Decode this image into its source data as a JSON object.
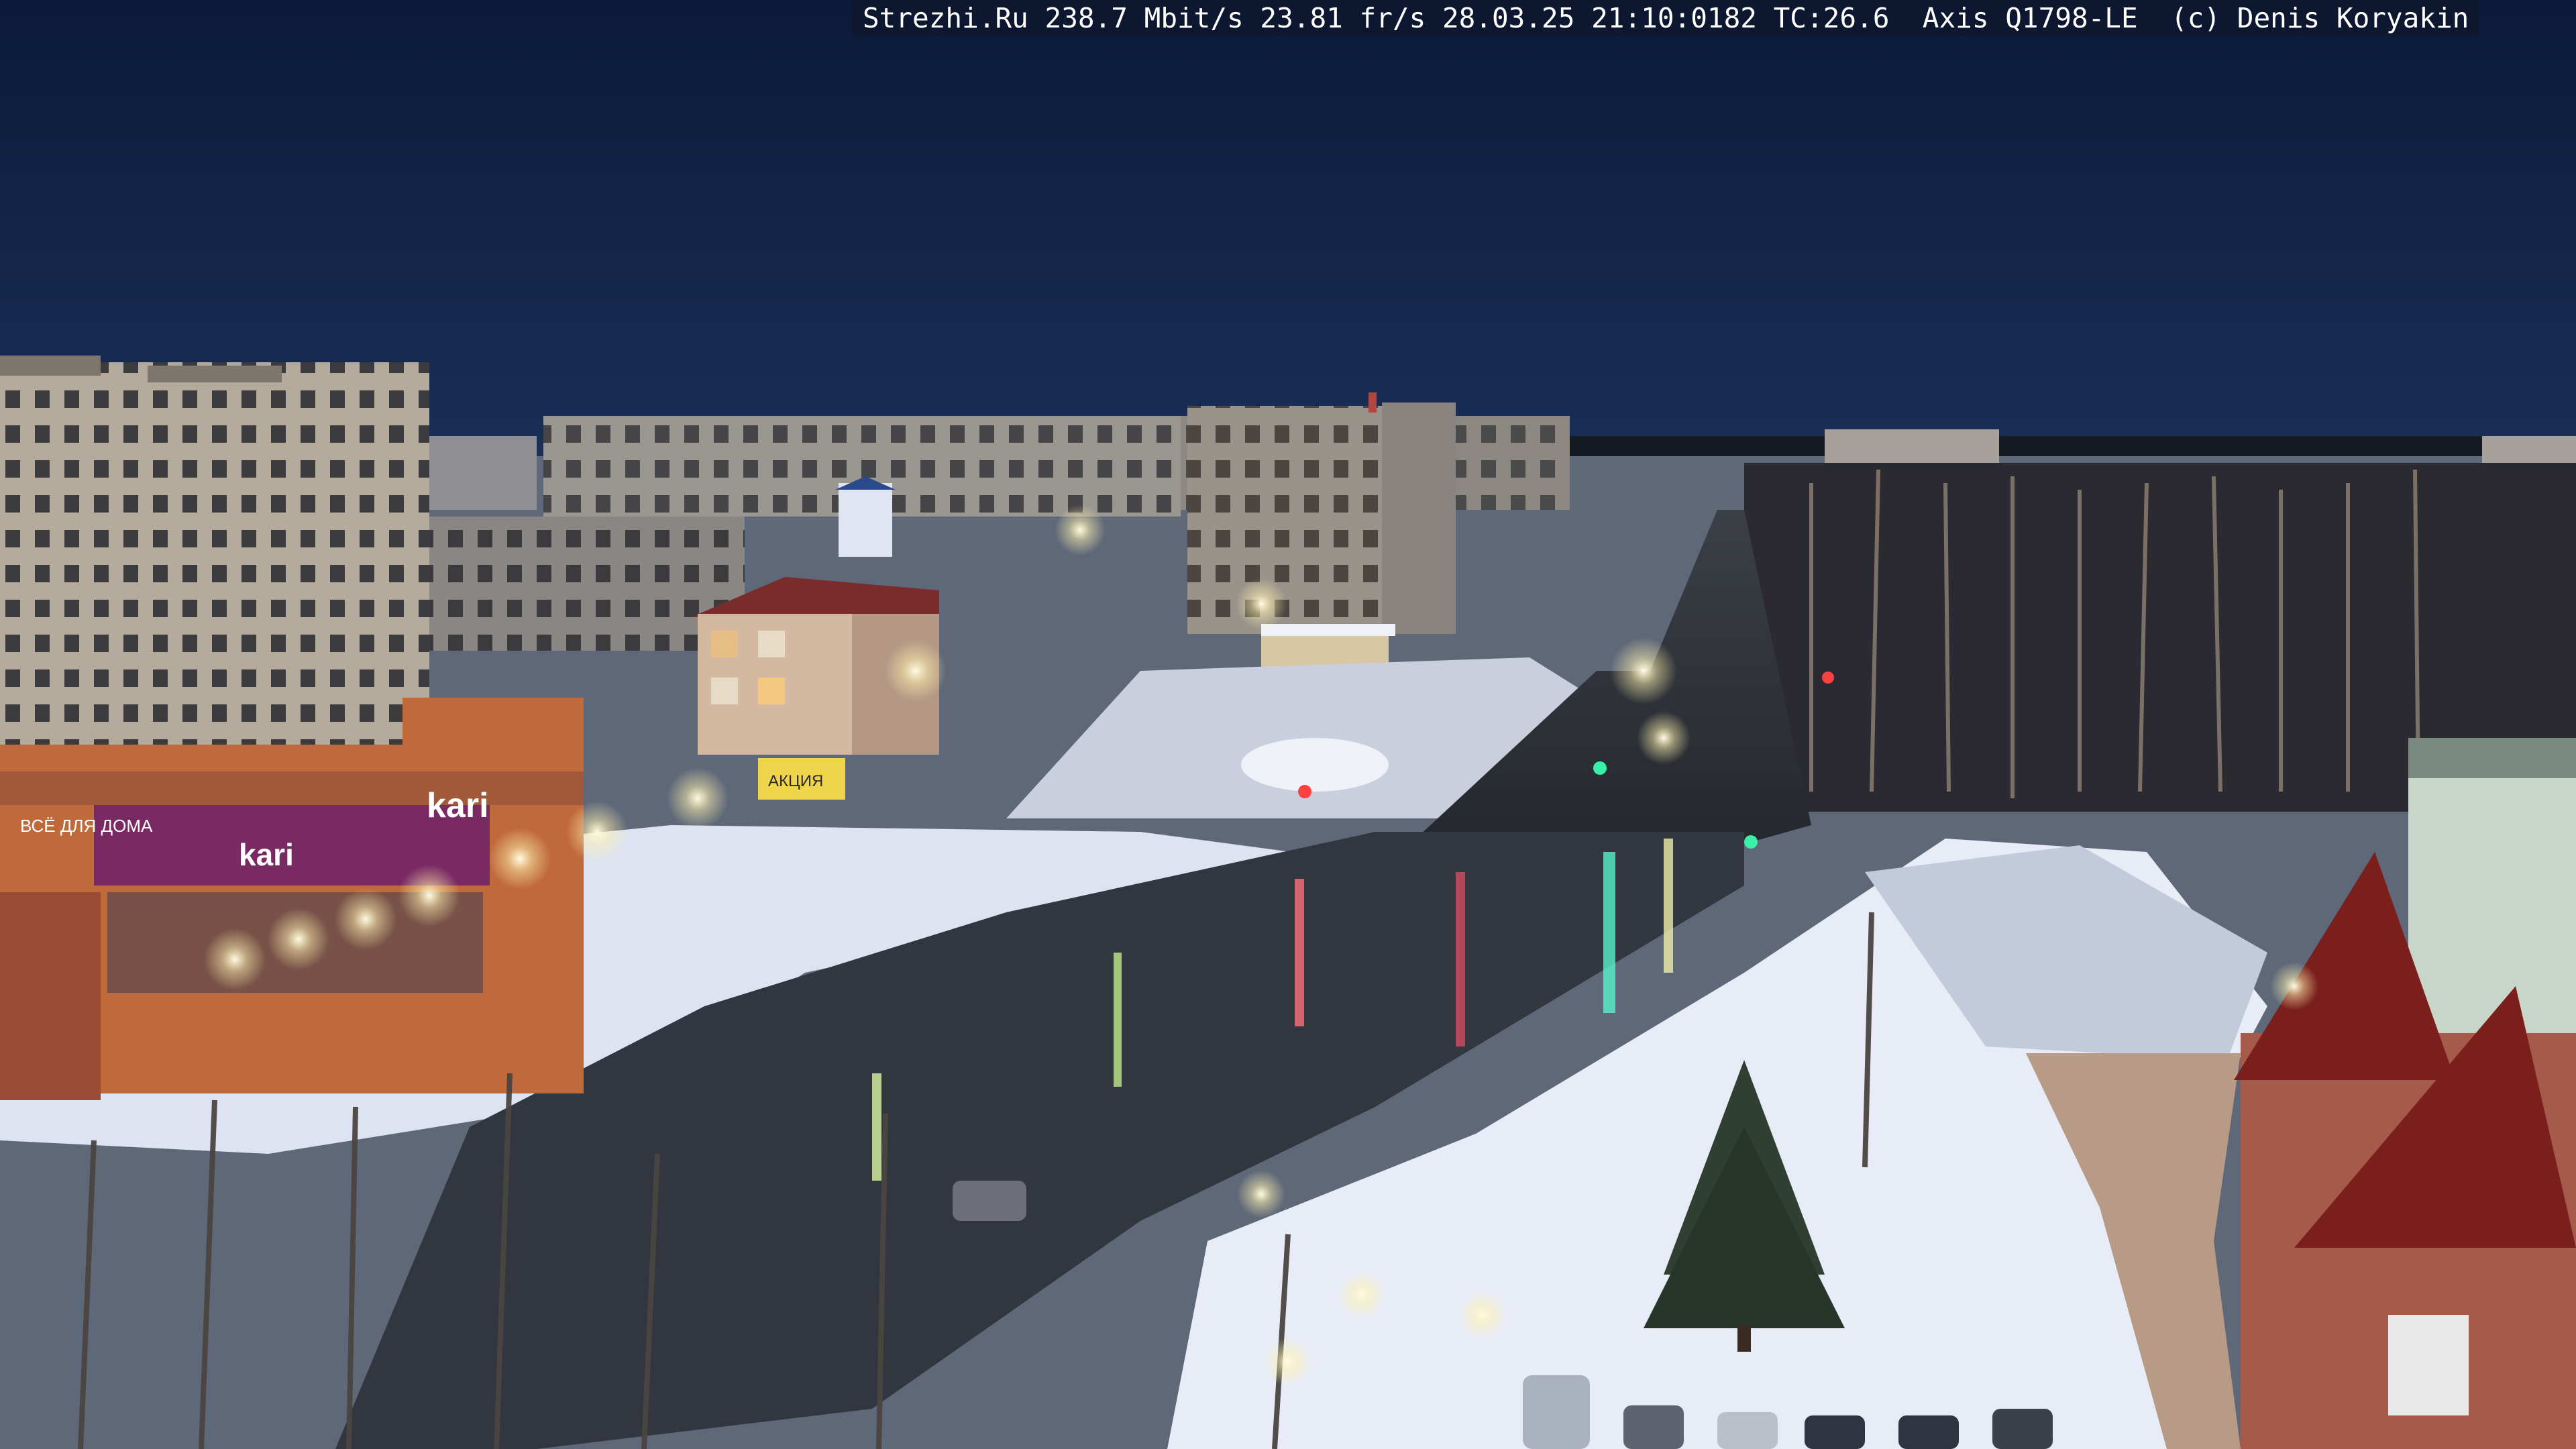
{
  "overlay": {
    "text": "Strezhi.Ru 238.7 Mbit/s 23.81 fr/s 28.03.25 21:10:0182 TC:26.6  Axis Q1798-LE  (c) Denis Koryakin"
  },
  "storefront_signs": {
    "main": "kari",
    "left": "ВСЁ ДЛЯ ДОМА",
    "small": "kari"
  },
  "billboard": {
    "text": "АКЦИЯ"
  },
  "colors": {
    "sky_top": "#0b1a38",
    "sky_horizon": "#1a2f57",
    "snow": "#e8ecf6",
    "road": "#2b2f36",
    "streetlight": "#fff7d6",
    "store_facade": "#c06a3c",
    "store_sign": "#7a2a63"
  }
}
